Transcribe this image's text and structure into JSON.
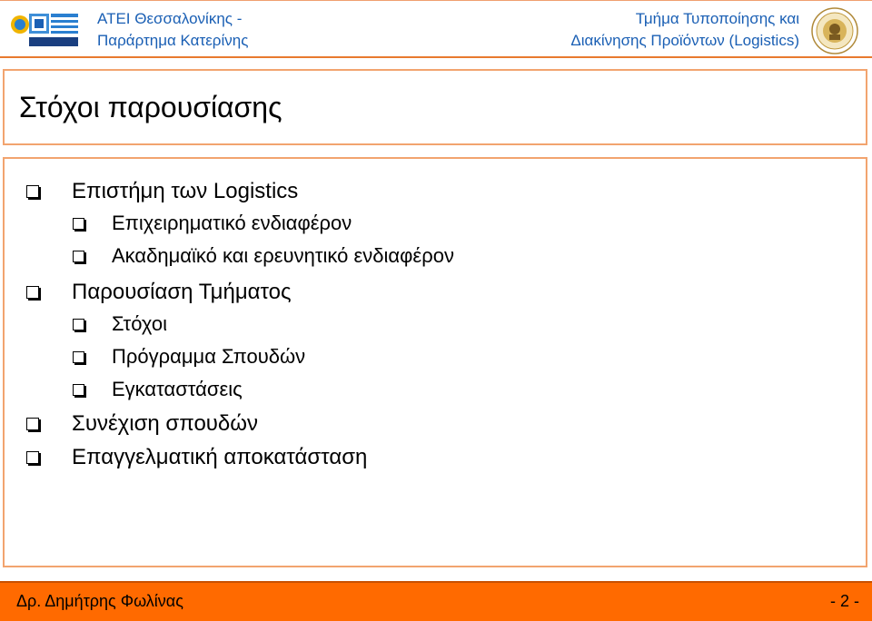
{
  "header": {
    "left_line1": "ΑΤΕΙ Θεσσαλονίκης -",
    "left_line2": "Παράρτημα Κατερίνης",
    "right_line1": "Τμήμα Τυποποίησης και",
    "right_line2": "Διακίνησης Προϊόντων (Logistics)",
    "left_logo_icon": "institution-logo",
    "right_logo_icon": "university-seal"
  },
  "title": "Στόχοι παρουσίασης",
  "bullets": [
    {
      "level": 1,
      "text": "Επιστήμη των Logistics"
    },
    {
      "level": 2,
      "text": "Επιχειρηματικό ενδιαφέρον"
    },
    {
      "level": 2,
      "text": "Ακαδημαϊκό και ερευνητικό ενδιαφέρον"
    },
    {
      "level": 1,
      "text": "Παρουσίαση Τμήματος"
    },
    {
      "level": 2,
      "text": "Στόχοι"
    },
    {
      "level": 2,
      "text": "Πρόγραμμα Σπουδών"
    },
    {
      "level": 2,
      "text": "Εγκαταστάσεις"
    },
    {
      "level": 1,
      "text": "Συνέχιση σπουδών"
    },
    {
      "level": 1,
      "text": "Επαγγελματική αποκατάσταση"
    }
  ],
  "footer": {
    "author": "Δρ. Δημήτρης Φωλίνας",
    "page": "- 2 -"
  },
  "colors": {
    "header_text": "#1a5fb4",
    "accent_border": "#f2a46f",
    "footer_bg": "#ff6a00"
  }
}
